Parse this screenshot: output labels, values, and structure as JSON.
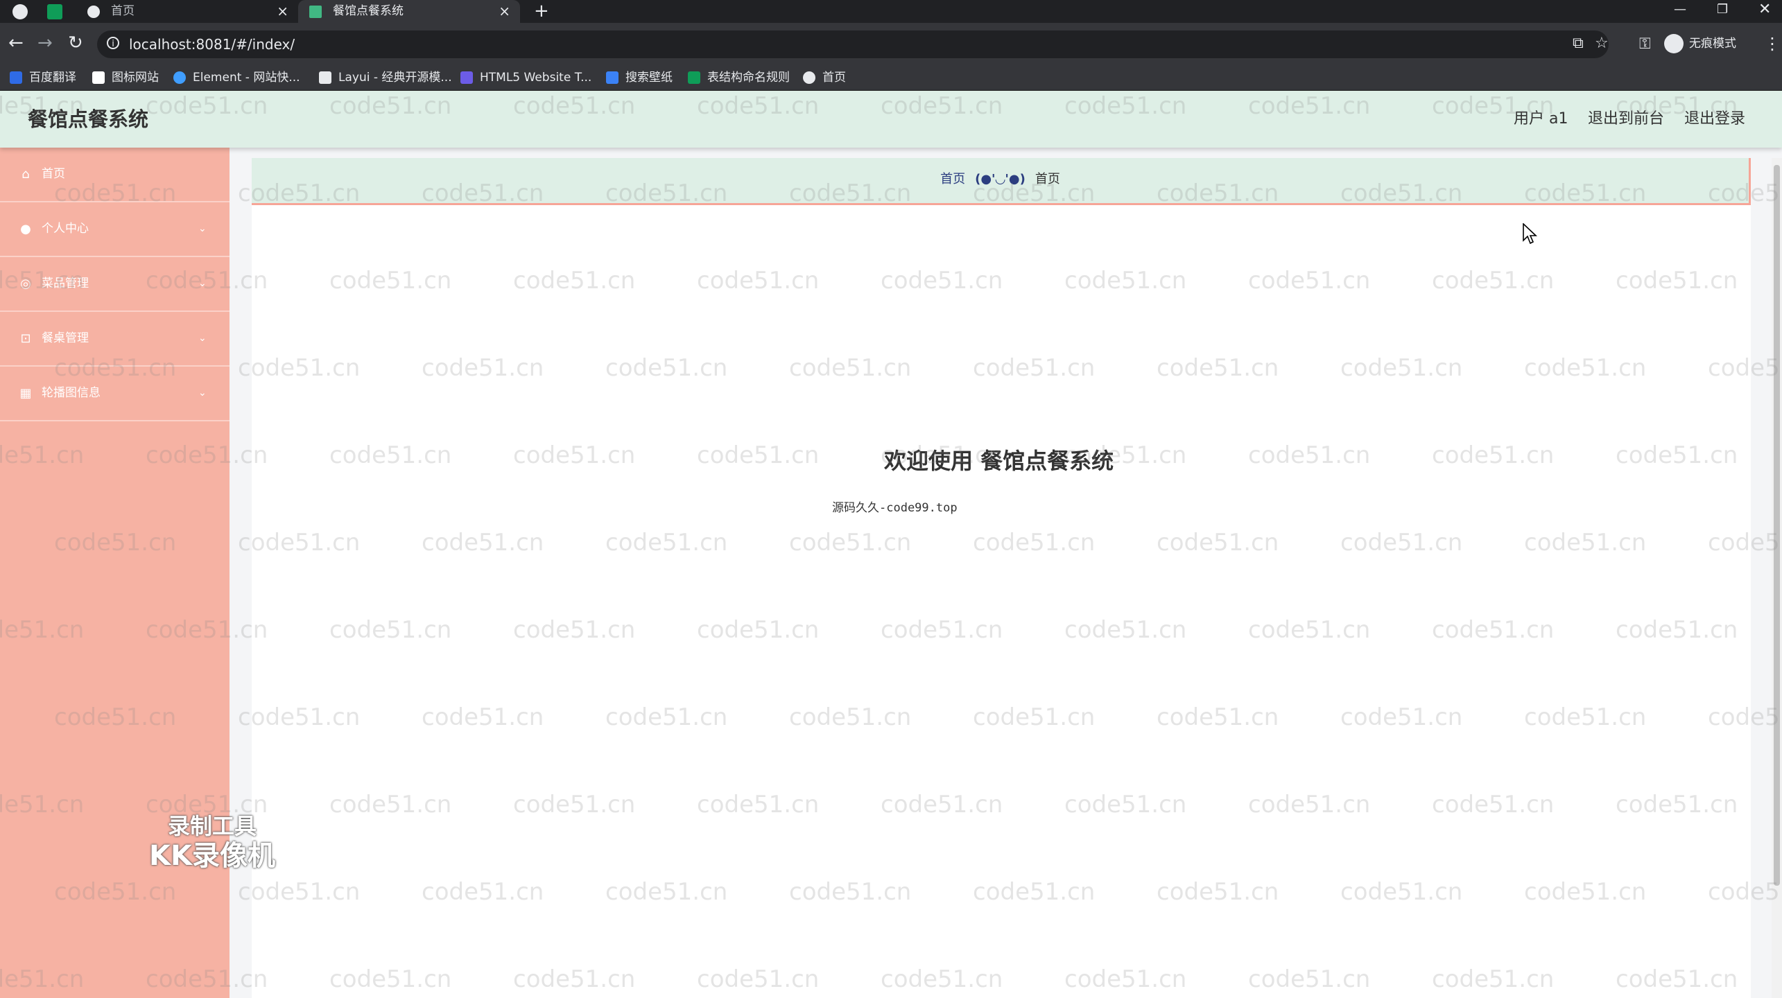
{
  "browser": {
    "tabs": [
      {
        "title": "首页",
        "active": false
      },
      {
        "title": "餐馆点餐系统",
        "active": true
      }
    ],
    "new_tab": "+",
    "url": "localhost:8081/#/index/",
    "profile_label": "无痕模式",
    "bookmarks": [
      {
        "label": "百度翻译",
        "color": "#2f6be6"
      },
      {
        "label": "图标网站",
        "color": "#ffffff"
      },
      {
        "label": "Element - 网站快...",
        "color": "#409eff"
      },
      {
        "label": "Layui - 经典开源模...",
        "color": "#e8eaed"
      },
      {
        "label": "HTML5 Website T...",
        "color": "#6c5ce7"
      },
      {
        "label": "搜索壁纸",
        "color": "#3b82f6"
      },
      {
        "label": "表结构命名规则",
        "color": "#0f9d58"
      },
      {
        "label": "首页",
        "color": "#e8eaed"
      }
    ]
  },
  "header": {
    "title": "餐馆点餐系统",
    "user": "用户 a1",
    "back_to_front": "退出到前台",
    "logout": "退出登录"
  },
  "sidebar": {
    "items": [
      {
        "label": "首页",
        "icon": "home-icon",
        "has_arrow": false
      },
      {
        "label": "个人中心",
        "icon": "user-icon",
        "has_arrow": true
      },
      {
        "label": "菜品管理",
        "icon": "dish-icon",
        "has_arrow": true
      },
      {
        "label": "餐桌管理",
        "icon": "table-icon",
        "has_arrow": true
      },
      {
        "label": "轮播图信息",
        "icon": "carousel-icon",
        "has_arrow": true
      }
    ]
  },
  "breadcrumb": {
    "home": "首页",
    "separator": "(●'◡'●)",
    "current": "首页"
  },
  "main": {
    "welcome": "欢迎使用 餐馆点餐系统",
    "subtext": "源码久久-code99.top"
  },
  "watermark": {
    "text": "code51.cn"
  },
  "recorder_overlay": {
    "line1": "录制工具",
    "line2": "KK录像机"
  },
  "colors": {
    "sidebar": "#f6b2a3",
    "header": "#deefe6",
    "accent": "#f6a597"
  }
}
